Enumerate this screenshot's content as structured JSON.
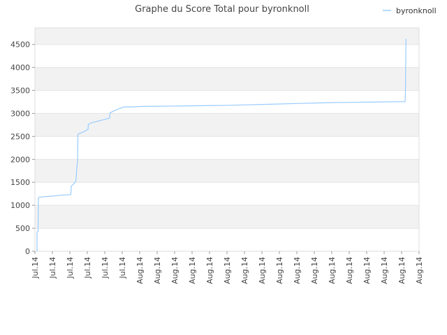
{
  "chart_data": {
    "type": "line",
    "title": "Graphe du Score Total pour byronknoll",
    "xlabel": "",
    "ylabel": "",
    "ylim": [
      0,
      4860
    ],
    "yticks": [
      0,
      500,
      1000,
      1500,
      2000,
      2500,
      3000,
      3500,
      4000,
      4500
    ],
    "xtick_labels": [
      "Jul.14",
      "Jul.14",
      "Jul.14",
      "Jul.14",
      "Jul.14",
      "Jul.14",
      "Aug.14",
      "Aug.14",
      "Aug.14",
      "Aug.14",
      "Aug.14",
      "Aug.14",
      "Aug.14",
      "Aug.14",
      "Aug.14",
      "Aug.14",
      "Aug.14",
      "Aug.14",
      "Aug.14",
      "Aug.14",
      "Aug.14",
      "Aug.14",
      "Aug.14"
    ],
    "grid": true,
    "background_bands": true,
    "legend_position": "top-right",
    "series": [
      {
        "name": "byronknoll",
        "color": "#99ccff",
        "points": [
          [
            0.12,
            0
          ],
          [
            0.12,
            420
          ],
          [
            0.18,
            430
          ],
          [
            0.2,
            1170
          ],
          [
            0.3,
            1180
          ],
          [
            0.6,
            1190
          ],
          [
            1.0,
            1200
          ],
          [
            1.5,
            1220
          ],
          [
            2.0,
            1230
          ],
          [
            2.06,
            1240
          ],
          [
            2.08,
            1420
          ],
          [
            2.15,
            1440
          ],
          [
            2.3,
            1500
          ],
          [
            2.35,
            1550
          ],
          [
            2.42,
            1900
          ],
          [
            2.45,
            2000
          ],
          [
            2.46,
            2550
          ],
          [
            2.6,
            2570
          ],
          [
            2.9,
            2620
          ],
          [
            3.0,
            2650
          ],
          [
            3.04,
            2650
          ],
          [
            3.06,
            2760
          ],
          [
            3.2,
            2790
          ],
          [
            3.6,
            2830
          ],
          [
            4.0,
            2870
          ],
          [
            4.2,
            2890
          ],
          [
            4.28,
            2900
          ],
          [
            4.3,
            3010
          ],
          [
            4.5,
            3050
          ],
          [
            4.8,
            3100
          ],
          [
            5.1,
            3140
          ],
          [
            5.5,
            3140
          ],
          [
            6.0,
            3150
          ],
          [
            6.5,
            3155
          ],
          [
            7.0,
            3155
          ],
          [
            8.0,
            3160
          ],
          [
            9.0,
            3165
          ],
          [
            10.0,
            3170
          ],
          [
            11.0,
            3175
          ],
          [
            12.0,
            3185
          ],
          [
            13.0,
            3195
          ],
          [
            14.0,
            3205
          ],
          [
            15.0,
            3215
          ],
          [
            16.0,
            3225
          ],
          [
            17.0,
            3235
          ],
          [
            18.0,
            3240
          ],
          [
            19.0,
            3245
          ],
          [
            20.0,
            3250
          ],
          [
            21.0,
            3255
          ],
          [
            21.2,
            3255
          ],
          [
            21.22,
            3480
          ],
          [
            21.25,
            4620
          ]
        ]
      }
    ]
  }
}
